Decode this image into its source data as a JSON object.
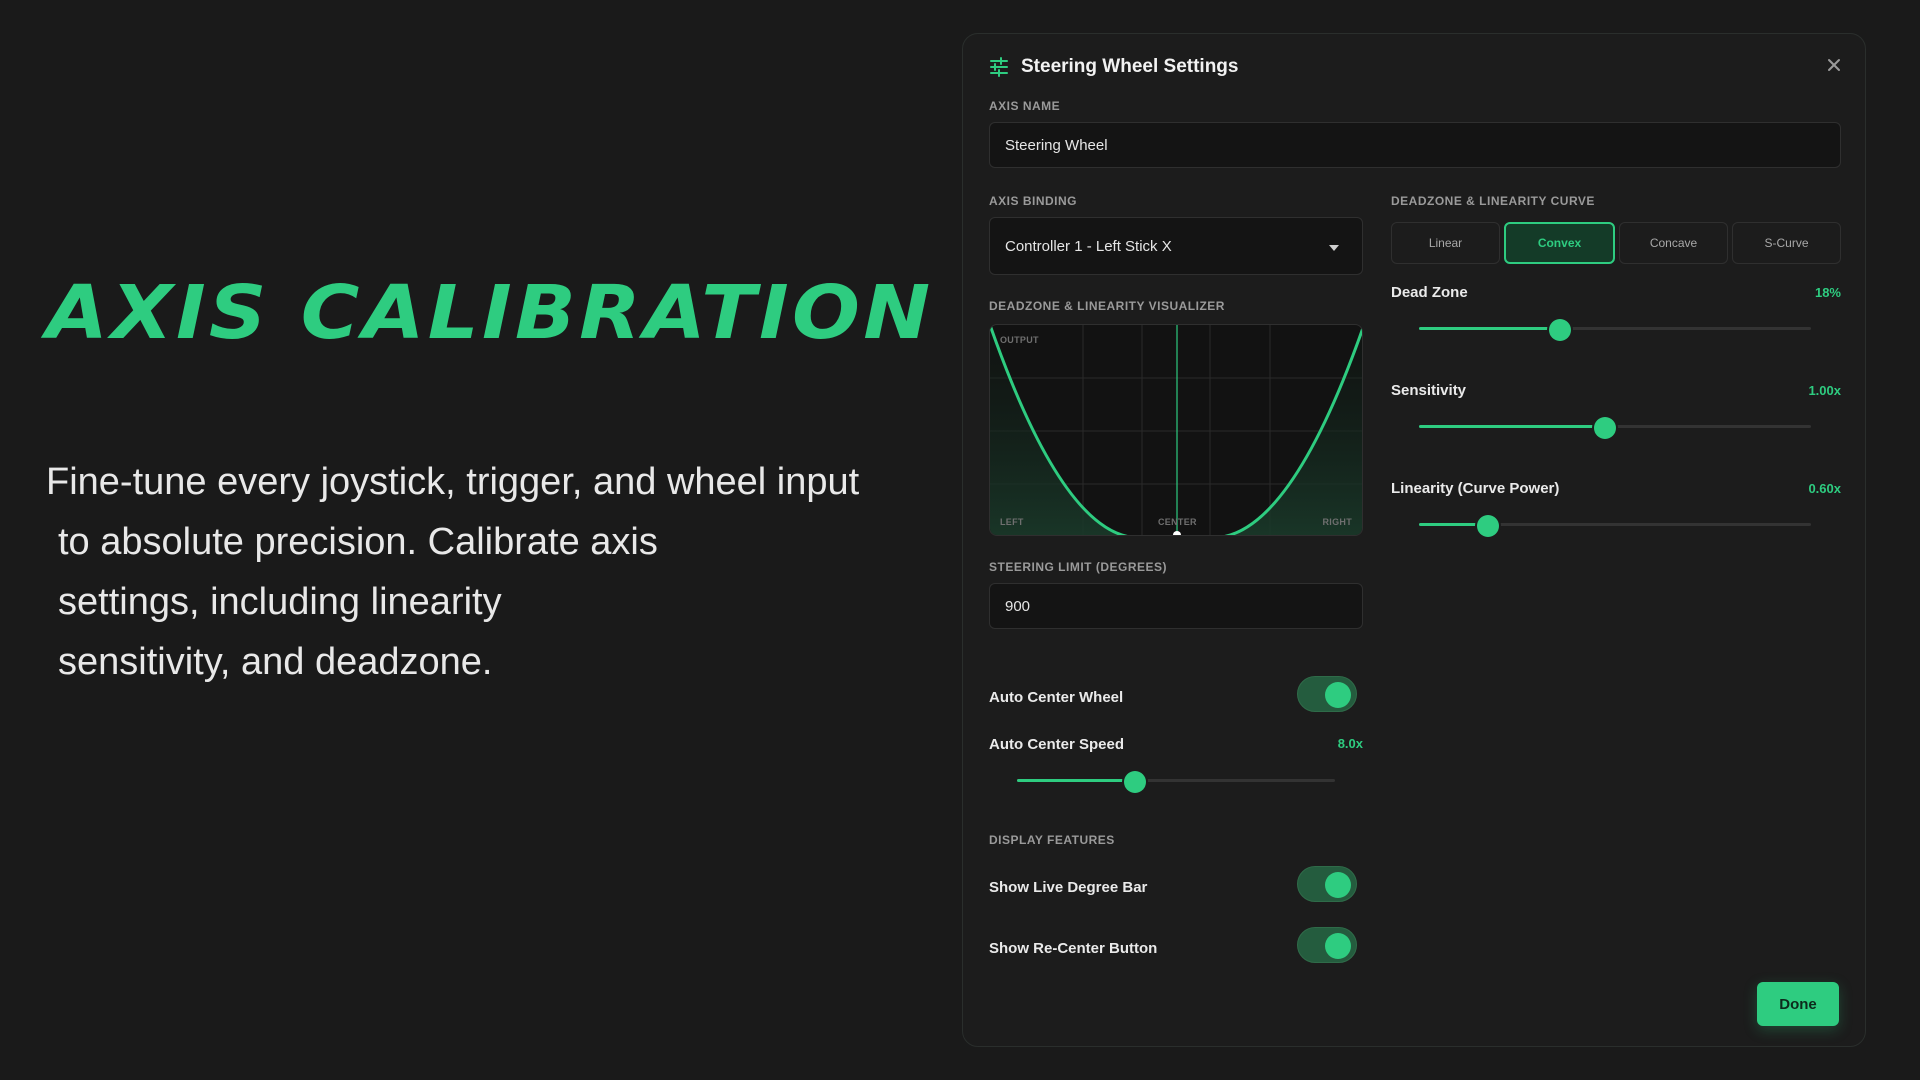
{
  "hero": {
    "title": "Axis Calibration",
    "description_lines": [
      "Fine-tune every joystick, trigger, and wheel input",
      "to absolute precision. Calibrate axis",
      "settings, including linearity",
      "sensitivity, and deadzone."
    ]
  },
  "panel": {
    "title": "Steering Wheel Settings",
    "icon": "sliders-icon",
    "close_icon": "close-icon",
    "axis_name": {
      "label": "AXIS NAME",
      "value": "Steering Wheel"
    },
    "axis_binding": {
      "label": "AXIS BINDING",
      "value": "Controller 1 - Left Stick X"
    },
    "visualizer": {
      "label": "DEADZONE & LINEARITY VISUALIZER",
      "output_label": "OUTPUT",
      "left_label": "LEFT",
      "center_label": "CENTER",
      "right_label": "RIGHT"
    },
    "curve": {
      "label": "DEADZONE & LINEARITY CURVE",
      "options": [
        "Linear",
        "Convex",
        "Concave",
        "S-Curve"
      ],
      "selected": "Convex"
    },
    "dead_zone": {
      "label": "Dead Zone",
      "value_text": "18%",
      "fraction": 0.36
    },
    "sensitivity": {
      "label": "Sensitivity",
      "value_text": "1.00x",
      "fraction": 0.475
    },
    "linearity": {
      "label": "Linearity (Curve Power)",
      "value_text": "0.60x",
      "fraction": 0.175
    },
    "steering_limit": {
      "label": "STEERING LIMIT (DEGREES)",
      "value": "900"
    },
    "auto_center": {
      "label": "Auto Center Wheel",
      "on": true
    },
    "auto_center_speed": {
      "label": "Auto Center Speed",
      "value_text": "8.0x",
      "fraction": 0.37
    },
    "display_features": {
      "label": "DISPLAY FEATURES",
      "live_degree_bar": {
        "label": "Show Live Degree Bar",
        "on": true
      },
      "recenter_button": {
        "label": "Show Re-Center Button",
        "on": true
      }
    },
    "done_label": "Done"
  },
  "colors": {
    "accent": "#2ecc80",
    "background": "#1a1a1a",
    "panel": "#1c1c1c"
  }
}
